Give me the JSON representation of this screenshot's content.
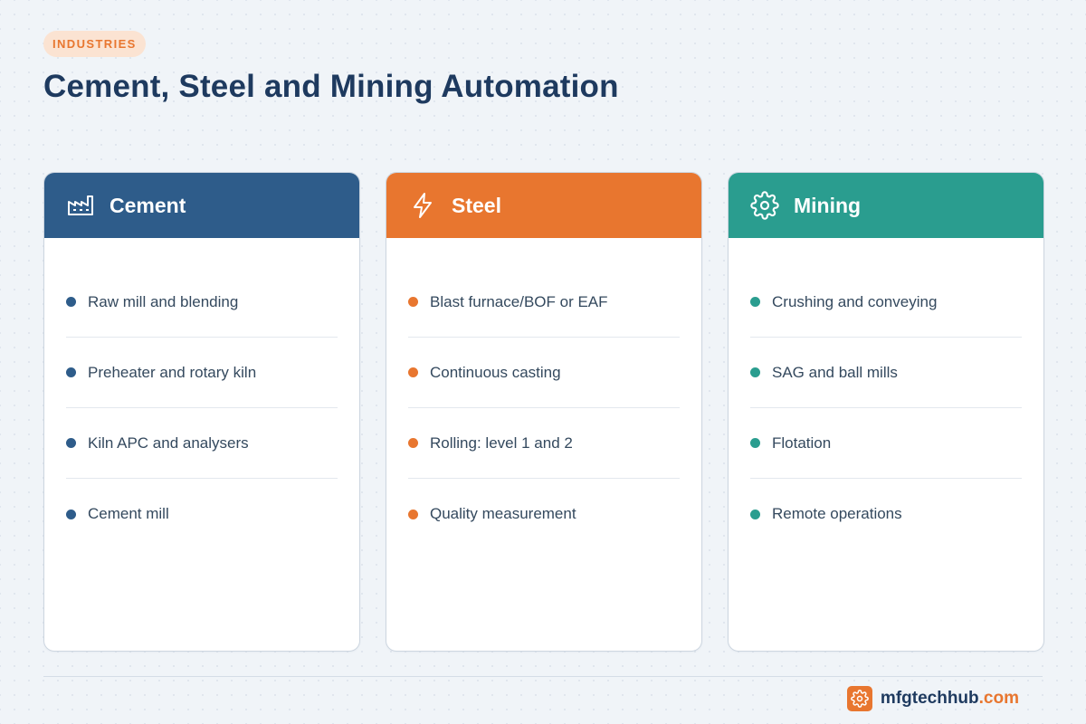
{
  "header": {
    "badge": "INDUSTRIES",
    "title": "Cement, Steel and Mining Automation"
  },
  "colors": {
    "cement": "#2e5c8a",
    "steel": "#e8762f",
    "mining": "#2a9d8f"
  },
  "cards": [
    {
      "title": "Cement",
      "icon": "factory-icon",
      "items": [
        "Raw mill and blending",
        "Preheater and rotary kiln",
        "Kiln APC and analysers",
        "Cement mill"
      ]
    },
    {
      "title": "Steel",
      "icon": "lightning-bolt-icon",
      "items": [
        "Blast furnace/BOF or EAF",
        "Continuous casting",
        "Rolling: level 1 and 2",
        "Quality measurement"
      ]
    },
    {
      "title": "Mining",
      "icon": "gear-icon",
      "items": [
        "Crushing and conveying",
        "SAG and ball mills",
        "Flotation",
        "Remote operations"
      ]
    }
  ],
  "footer": {
    "brand_name": "mfgtechhub",
    "brand_tld": ".com",
    "logo_icon": "gear-icon"
  }
}
